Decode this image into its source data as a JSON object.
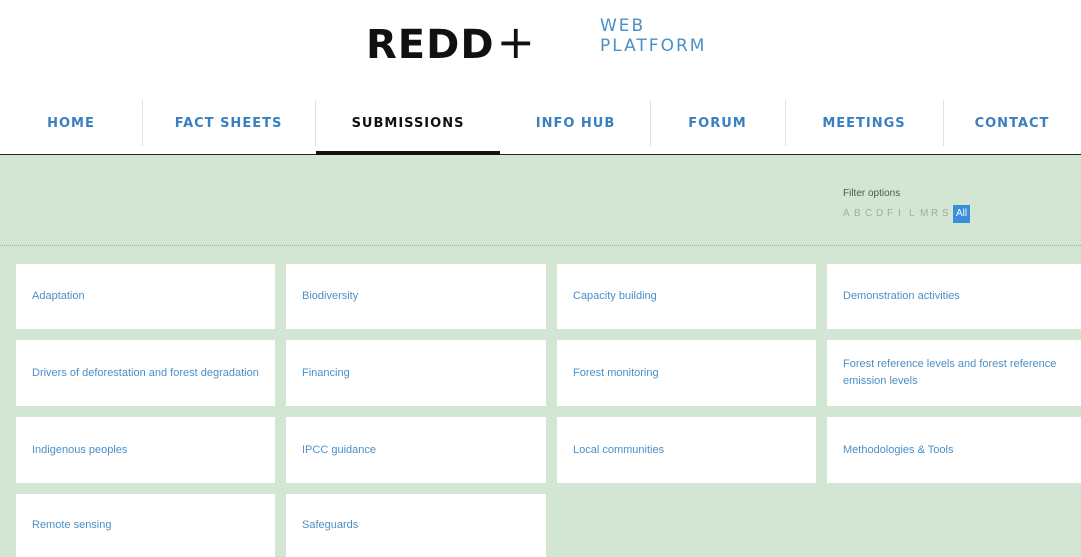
{
  "logo": {
    "main": "REDD",
    "plus": "+",
    "sub_line1": "WEB",
    "sub_line2": "PLATFORM"
  },
  "nav": {
    "items": [
      {
        "label": "HOME"
      },
      {
        "label": "FACT SHEETS"
      },
      {
        "label": "SUBMISSIONS",
        "active": true
      },
      {
        "label": "INFO HUB"
      },
      {
        "label": "FORUM"
      },
      {
        "label": "MEETINGS"
      },
      {
        "label": "CONTACT"
      }
    ]
  },
  "filter": {
    "label": "Filter options",
    "letters": [
      "A",
      "B",
      "C",
      "D",
      "F",
      "I",
      "L",
      "M",
      "R",
      "S"
    ],
    "all_label": "All"
  },
  "topics": [
    "Adaptation",
    "Biodiversity",
    "Capacity building",
    "Demonstration activities",
    "Drivers of deforestation and forest degradation",
    "Financing",
    "Forest monitoring",
    "Forest reference levels and forest reference emission levels",
    "Indigenous peoples",
    "IPCC guidance",
    "Local communities",
    "Methodologies & Tools",
    "Remote sensing",
    "Safeguards"
  ],
  "colors": {
    "accent_blue": "#3a7fc0",
    "content_bg": "#d3e6d4",
    "active_bar": "#111111"
  }
}
